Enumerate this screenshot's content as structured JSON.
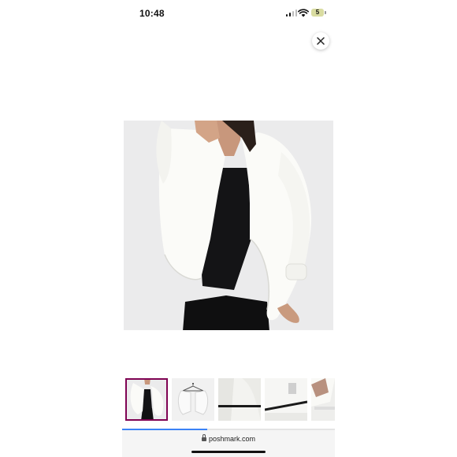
{
  "status_bar": {
    "time": "10:48",
    "battery_level": "5",
    "signal_icon": "cellular-signal-icon",
    "wifi_icon": "wifi-icon"
  },
  "viewer": {
    "close_icon": "close-icon",
    "main_image_alt": "white cardigan product photo",
    "thumbnails": [
      {
        "name": "thumbnail-1",
        "selected": true
      },
      {
        "name": "thumbnail-2",
        "selected": false
      },
      {
        "name": "thumbnail-3",
        "selected": false
      },
      {
        "name": "thumbnail-4",
        "selected": false
      },
      {
        "name": "thumbnail-5",
        "selected": false
      }
    ],
    "accent_color": "#7f0353"
  },
  "browser": {
    "url": "poshmark.com",
    "load_progress": 0.4,
    "progress_color": "#3b82f6"
  }
}
